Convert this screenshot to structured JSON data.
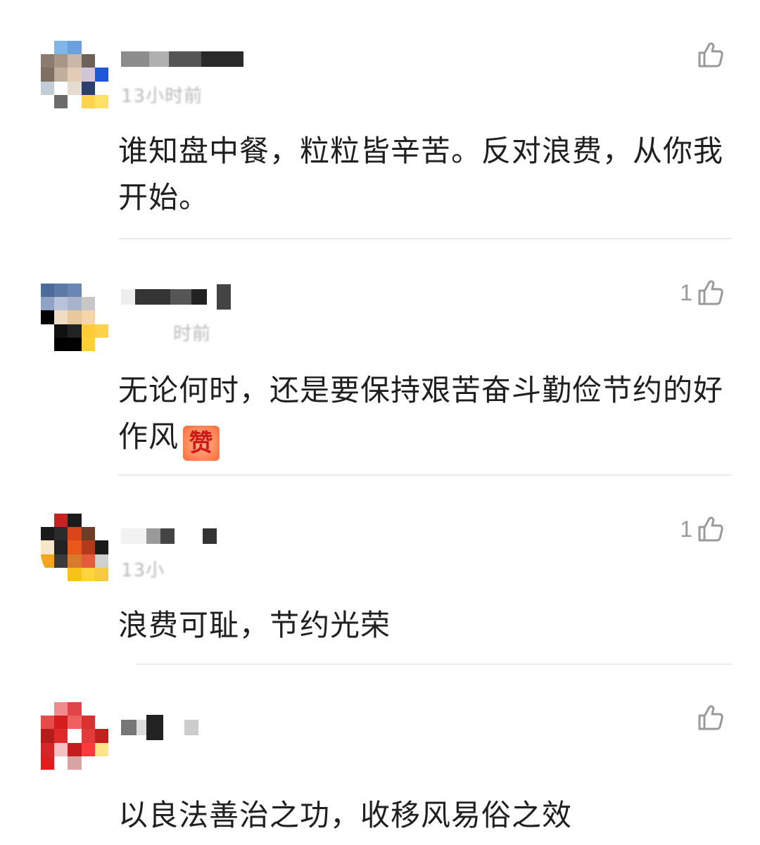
{
  "comments": [
    {
      "timestamp": "13小时前",
      "text": "谁知盘中餐，粒粒皆辛苦。反对浪费，从你我开始。",
      "likes": "",
      "avatar_colors": [
        "#ffffff",
        "#7fb6e8",
        "#6aa0de",
        "#ffffff",
        "#ffffff",
        "#8a7c6e",
        "#a89584",
        "#c9b8a7",
        "#6e6258",
        "#ffffff",
        "#7d6f62",
        "#bfae9b",
        "#e4cbb5",
        "#cfc7d8",
        "#1e57d6",
        "#c2cdd6",
        "#ffffff",
        "#e5dccf",
        "#2b3f6e",
        "#ffffff",
        "#ffffff",
        "#6b6b6b",
        "#ffffff",
        "#ffd34d",
        "#ffe066"
      ]
    },
    {
      "timestamp": "时前",
      "text": "无论何时，还是要保持艰苦奋斗勤俭节约的好作风",
      "emoji": "赞",
      "likes": "1",
      "avatar_colors": [
        "#4b6b99",
        "#5d7aa6",
        "#6a86b2",
        "#ffffff",
        "#ffffff",
        "#8fa3c7",
        "#b8c3d9",
        "#a8b4cc",
        "#c7c7c7",
        "#ffffff",
        "#000000",
        "#f0dcc0",
        "#e8c79b",
        "#f5d6a8",
        "#ffffff",
        "#ffffff",
        "#111111",
        "#222222",
        "#ffcc33",
        "#ffd24d",
        "#ffffff",
        "#000000",
        "#000000",
        "#ffd034",
        "#ffffff"
      ]
    },
    {
      "timestamp": "13小",
      "text": "浪费可耻，节约光荣",
      "likes": "1",
      "avatar_colors": [
        "#ffffff",
        "#c82121",
        "#1c1c1c",
        "#ffffff",
        "#ffffff",
        "#1a1a1a",
        "#2a2a2a",
        "#d9441a",
        "#6d3d2a",
        "#ffffff",
        "#f7e6c8",
        "#222222",
        "#e85a1a",
        "#b33a1a",
        "#1a1a1a",
        "#f2a81a",
        "#3a3a3a",
        "#d97a2a",
        "#e55a3a",
        "#cfcfcf",
        "#ffffff",
        "#ffffff",
        "#f7c21a",
        "#ffd43a",
        "#f5c842"
      ]
    },
    {
      "timestamp": "",
      "text": "以良法善治之功，收移风易俗之效",
      "likes": "",
      "avatar_colors": [
        "#ffffff",
        "#f08a8a",
        "#e24545",
        "#ffffff",
        "#ffffff",
        "#e84a4a",
        "#d41e1e",
        "#f06060",
        "#d93030",
        "#ffffff",
        "#b51b1b",
        "#e02a2a",
        "#ffffff",
        "#e33a3a",
        "#c21f1f",
        "#d42626",
        "#f4c2c2",
        "#c51d1d",
        "#ff3b3b",
        "#ffe48a",
        "#e01c1c",
        "#ffffff",
        "#d9a3a3",
        "#ffffff",
        "#ffffff"
      ]
    }
  ]
}
